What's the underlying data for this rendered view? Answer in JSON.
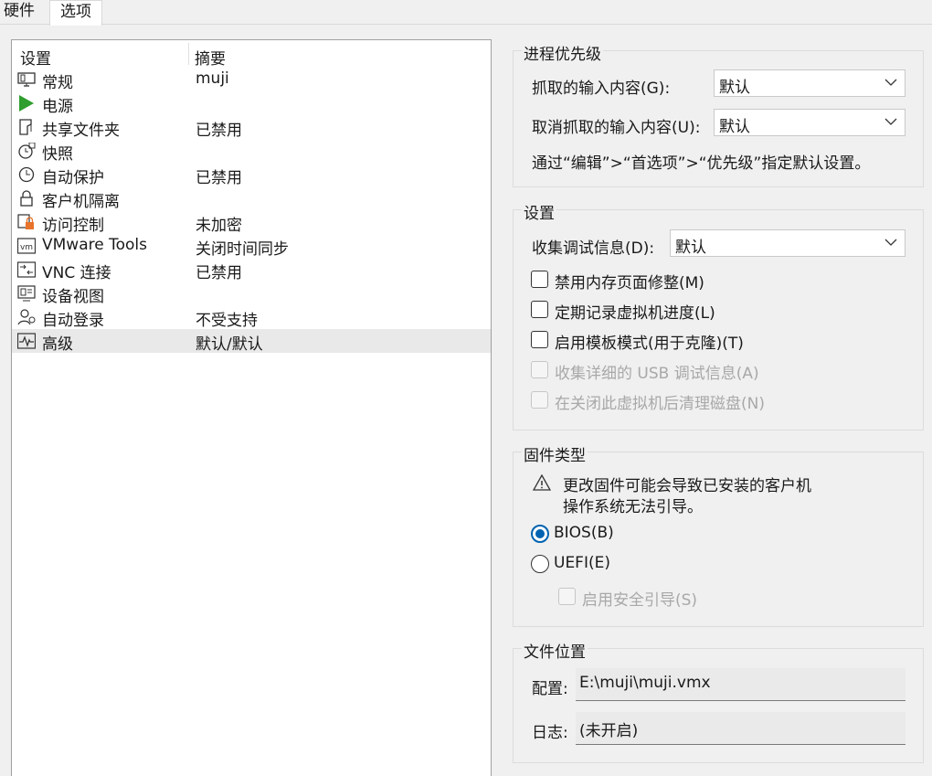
{
  "tabs": [
    "硬件",
    "选项"
  ],
  "list": {
    "headers": [
      "设置",
      "摘要"
    ],
    "rows": [
      {
        "label": "常规",
        "summary": "muji",
        "icon": "monitor-icon"
      },
      {
        "label": "电源",
        "summary": "",
        "icon": "power-play-icon"
      },
      {
        "label": "共享文件夹",
        "summary": "已禁用",
        "icon": "shared-folder-icon"
      },
      {
        "label": "快照",
        "summary": "",
        "icon": "snapshot-clock-icon"
      },
      {
        "label": "自动保护",
        "summary": "已禁用",
        "icon": "autoprotect-clock-icon"
      },
      {
        "label": "客户机隔离",
        "summary": "",
        "icon": "lock-icon"
      },
      {
        "label": "访问控制",
        "summary": "未加密",
        "icon": "access-control-lock-icon"
      },
      {
        "label": "VMware Tools",
        "summary": "关闭时间同步",
        "icon": "vmware-tools-icon"
      },
      {
        "label": "VNC 连接",
        "summary": "已禁用",
        "icon": "vnc-icon"
      },
      {
        "label": "设备视图",
        "summary": "",
        "icon": "device-view-icon"
      },
      {
        "label": "自动登录",
        "summary": "不受支持",
        "icon": "autologin-user-icon"
      },
      {
        "label": "高级",
        "summary": "默认/默认",
        "icon": "advanced-pulse-icon",
        "selected": true
      }
    ]
  },
  "priority": {
    "title": "进程优先级",
    "grabbed_label": "抓取的输入内容(G):",
    "grabbed_value": "默认",
    "ungrabbed_label": "取消抓取的输入内容(U):",
    "ungrabbed_value": "默认",
    "hint": "通过“编辑”>“首选项”>“优先级”指定默认设置。"
  },
  "settings": {
    "title": "设置",
    "debug_label": "收集调试信息(D):",
    "debug_value": "默认",
    "checkboxes": [
      {
        "label": "禁用内存页面修整(M)",
        "checked": false,
        "enabled": true
      },
      {
        "label": "定期记录虚拟机进度(L)",
        "checked": false,
        "enabled": true
      },
      {
        "label": "启用模板模式(用于克隆)(T)",
        "checked": false,
        "enabled": true
      },
      {
        "label": "收集详细的 USB 调试信息(A)",
        "checked": false,
        "enabled": false
      },
      {
        "label": "在关闭此虚拟机后清理磁盘(N)",
        "checked": false,
        "enabled": false
      }
    ]
  },
  "firmware": {
    "title": "固件类型",
    "warning_line1": "更改固件可能会导致已安装的客户机",
    "warning_line2": "操作系统无法引导。",
    "bios_label": "BIOS(B)",
    "uefi_label": "UEFI(E)",
    "selected": "BIOS",
    "secure_boot_label": "启用安全引导(S)"
  },
  "file_location": {
    "title": "文件位置",
    "config_label": "配置:",
    "config_value": "E:\\muji\\muji.vmx",
    "log_label": "日志:",
    "log_value": "(未开启)"
  },
  "colors": {
    "accent": "#0063b1",
    "play": "#2e9e2e",
    "lock_accent": "#e8732a"
  }
}
